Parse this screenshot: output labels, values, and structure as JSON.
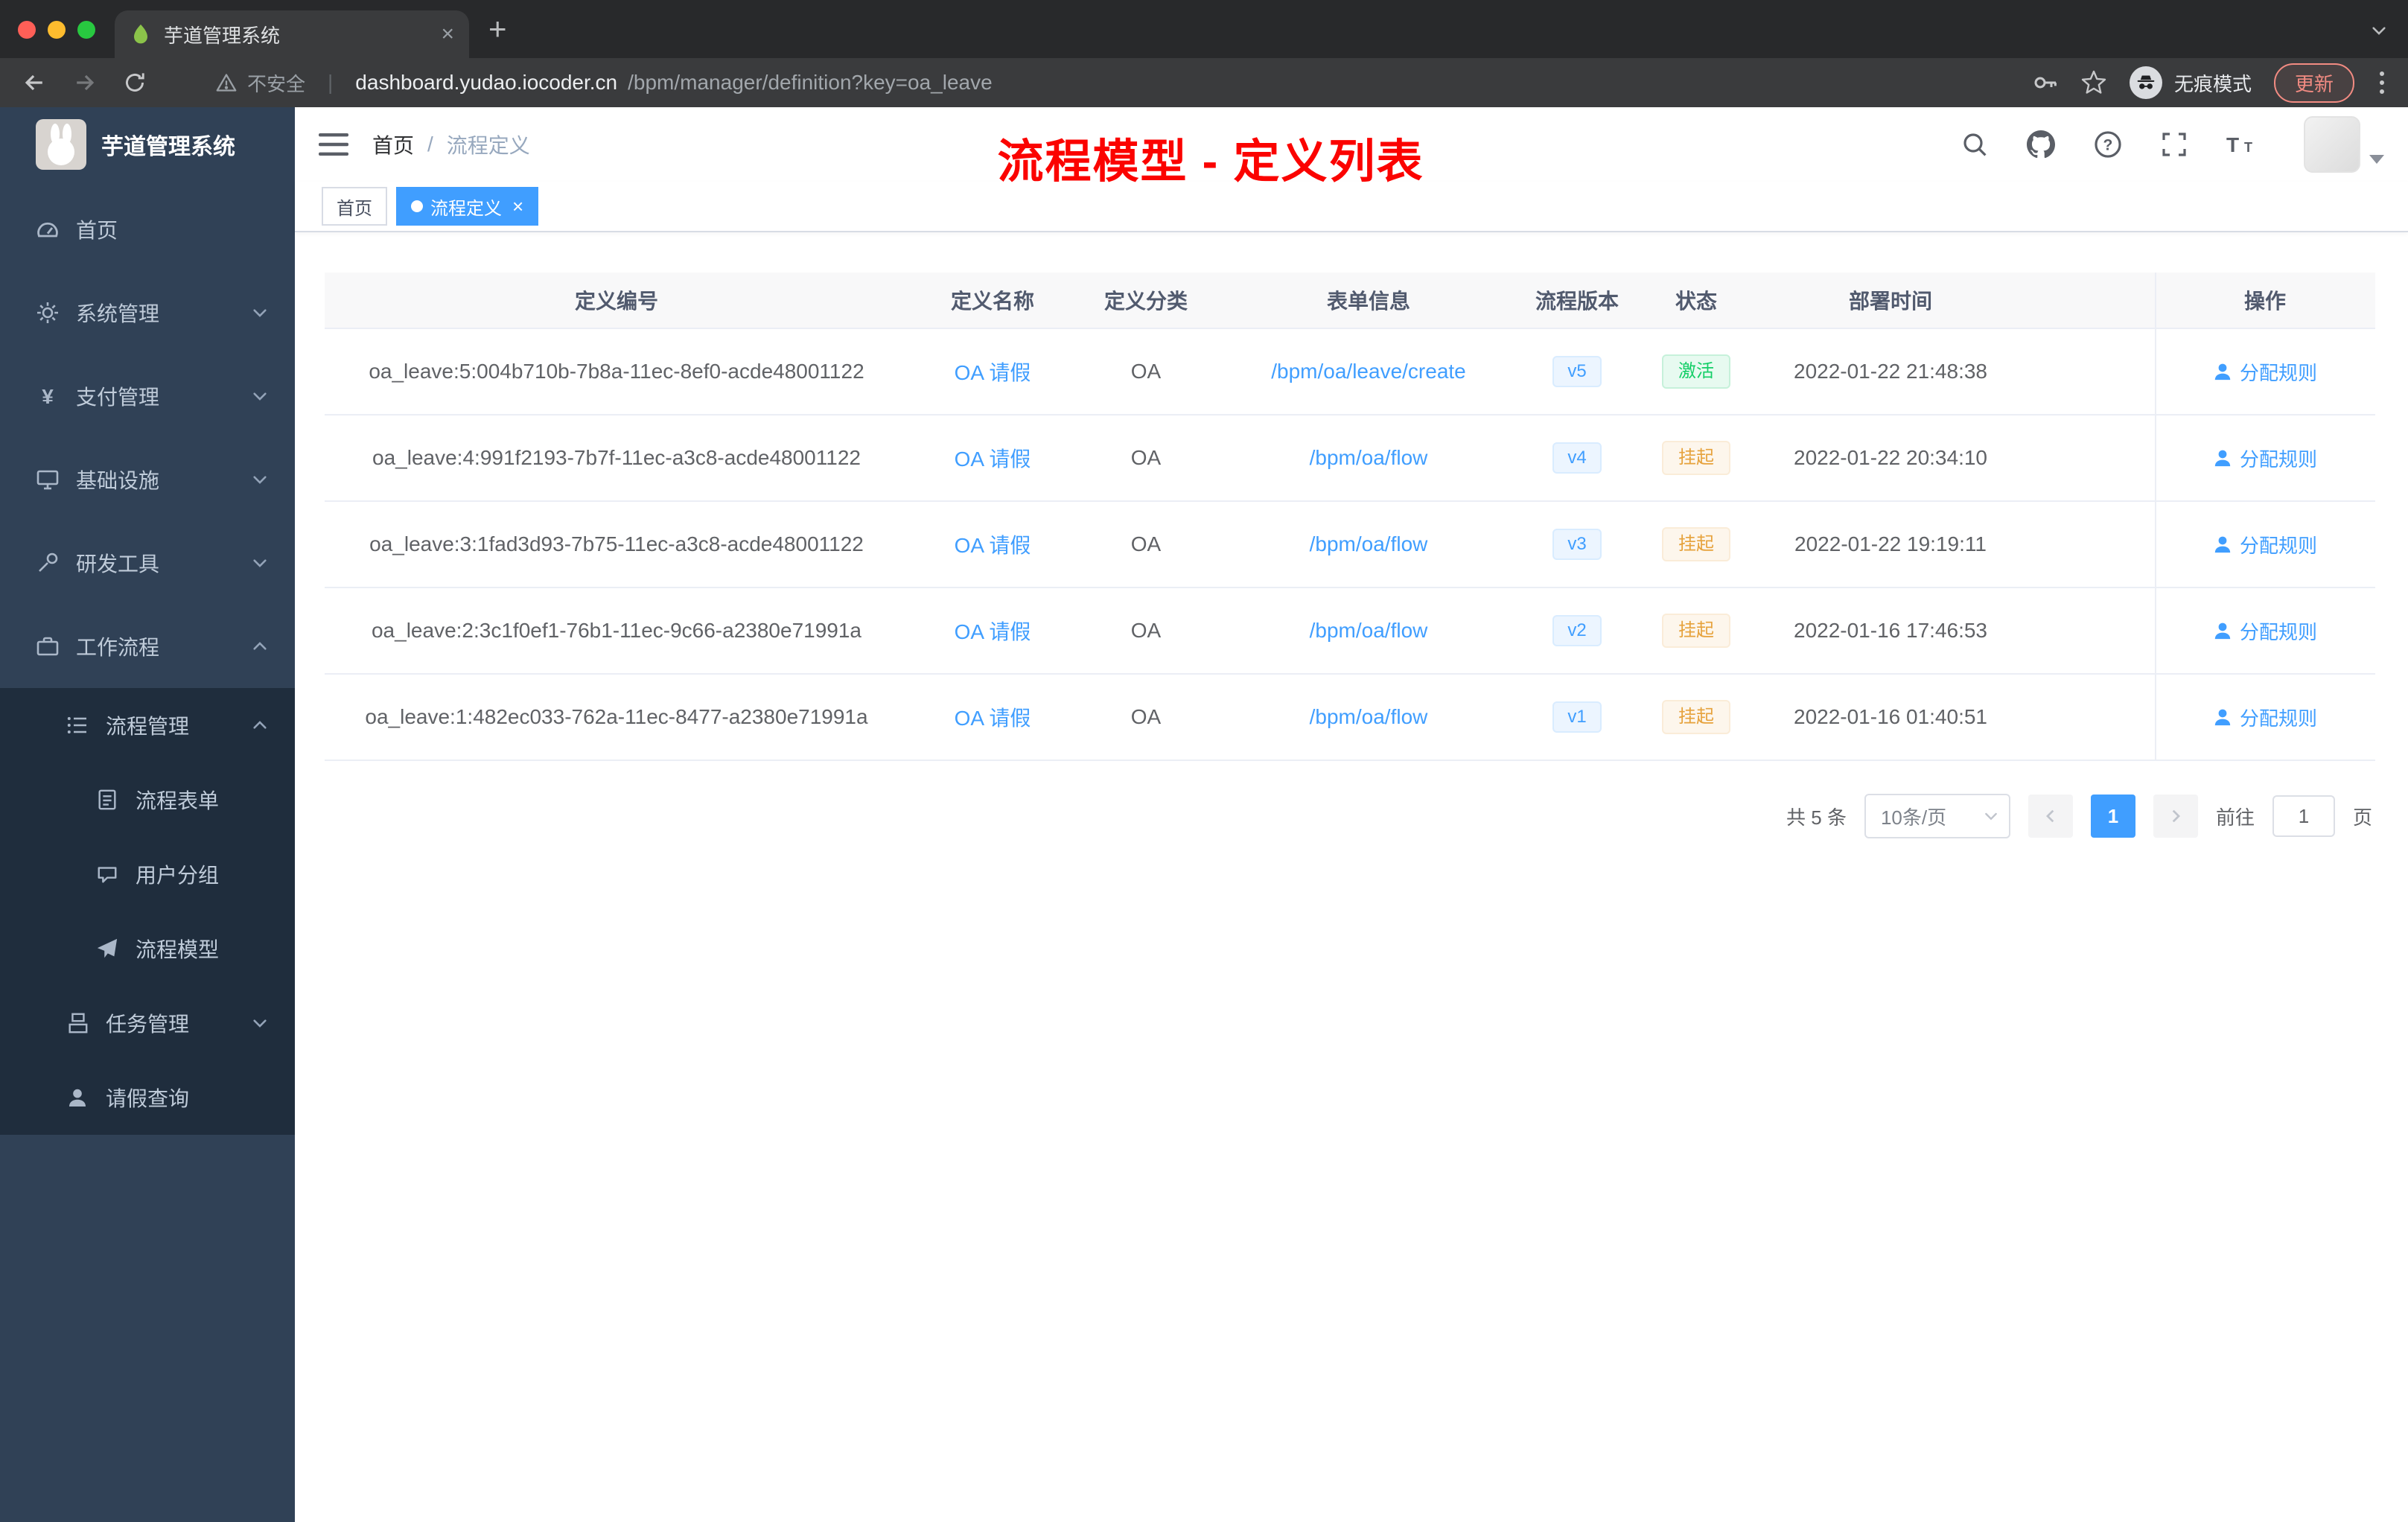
{
  "browser": {
    "tab": {
      "title": "芋道管理系统",
      "close": "×",
      "new_tab": "+"
    },
    "url": {
      "security": "不安全",
      "divider": "|",
      "domain": "dashboard.yudao.iocoder.cn",
      "path": "/bpm/manager/definition?key=oa_leave"
    },
    "incognito_label": "无痕模式",
    "update_label": "更新"
  },
  "sidebar": {
    "logo_title": "芋道管理系统",
    "items": [
      {
        "label": "首页"
      },
      {
        "label": "系统管理"
      },
      {
        "label": "支付管理"
      },
      {
        "label": "基础设施"
      },
      {
        "label": "研发工具"
      },
      {
        "label": "工作流程"
      },
      {
        "label": "流程管理"
      },
      {
        "label": "流程表单"
      },
      {
        "label": "用户分组"
      },
      {
        "label": "流程模型"
      },
      {
        "label": "任务管理"
      },
      {
        "label": "请假查询"
      }
    ]
  },
  "header": {
    "breadcrumb_home": "首页",
    "breadcrumb_sep": "/",
    "breadcrumb_current": "流程定义",
    "annotation": "流程模型 - 定义列表"
  },
  "tags": {
    "home": "首页",
    "current": "流程定义",
    "close": "×"
  },
  "table": {
    "columns": [
      "定义编号",
      "定义名称",
      "定义分类",
      "表单信息",
      "流程版本",
      "状态",
      "部署时间",
      "操作"
    ],
    "rows": [
      {
        "id": "oa_leave:5:004b710b-7b8a-11ec-8ef0-acde48001122",
        "name": "OA 请假",
        "category": "OA",
        "form": "/bpm/oa/leave/create",
        "version": "v5",
        "status": "激活",
        "status_type": "success",
        "time": "2022-01-22 21:48:38",
        "action": "分配规则"
      },
      {
        "id": "oa_leave:4:991f2193-7b7f-11ec-a3c8-acde48001122",
        "name": "OA 请假",
        "category": "OA",
        "form": "/bpm/oa/flow",
        "version": "v4",
        "status": "挂起",
        "status_type": "warning",
        "time": "2022-01-22 20:34:10",
        "action": "分配规则"
      },
      {
        "id": "oa_leave:3:1fad3d93-7b75-11ec-a3c8-acde48001122",
        "name": "OA 请假",
        "category": "OA",
        "form": "/bpm/oa/flow",
        "version": "v3",
        "status": "挂起",
        "status_type": "warning",
        "time": "2022-01-22 19:19:11",
        "action": "分配规则"
      },
      {
        "id": "oa_leave:2:3c1f0ef1-76b1-11ec-9c66-a2380e71991a",
        "name": "OA 请假",
        "category": "OA",
        "form": "/bpm/oa/flow",
        "version": "v2",
        "status": "挂起",
        "status_type": "warning",
        "time": "2022-01-16 17:46:53",
        "action": "分配规则"
      },
      {
        "id": "oa_leave:1:482ec033-762a-11ec-8477-a2380e71991a",
        "name": "OA 请假",
        "category": "OA",
        "form": "/bpm/oa/flow",
        "version": "v1",
        "status": "挂起",
        "status_type": "warning",
        "time": "2022-01-16 01:40:51",
        "action": "分配规则"
      }
    ]
  },
  "pagination": {
    "total": "共 5 条",
    "page_size": "10条/页",
    "page": "1",
    "goto_label": "前往",
    "goto_value": "1",
    "unit_label": "页"
  },
  "colors": {
    "accent": "#409eff",
    "success": "#13ce66",
    "warning": "#e6a23c",
    "annotation_red": "#fb0300",
    "sidebar_bg": "#304156",
    "sidebar_sub_bg": "#1f2d3d"
  }
}
